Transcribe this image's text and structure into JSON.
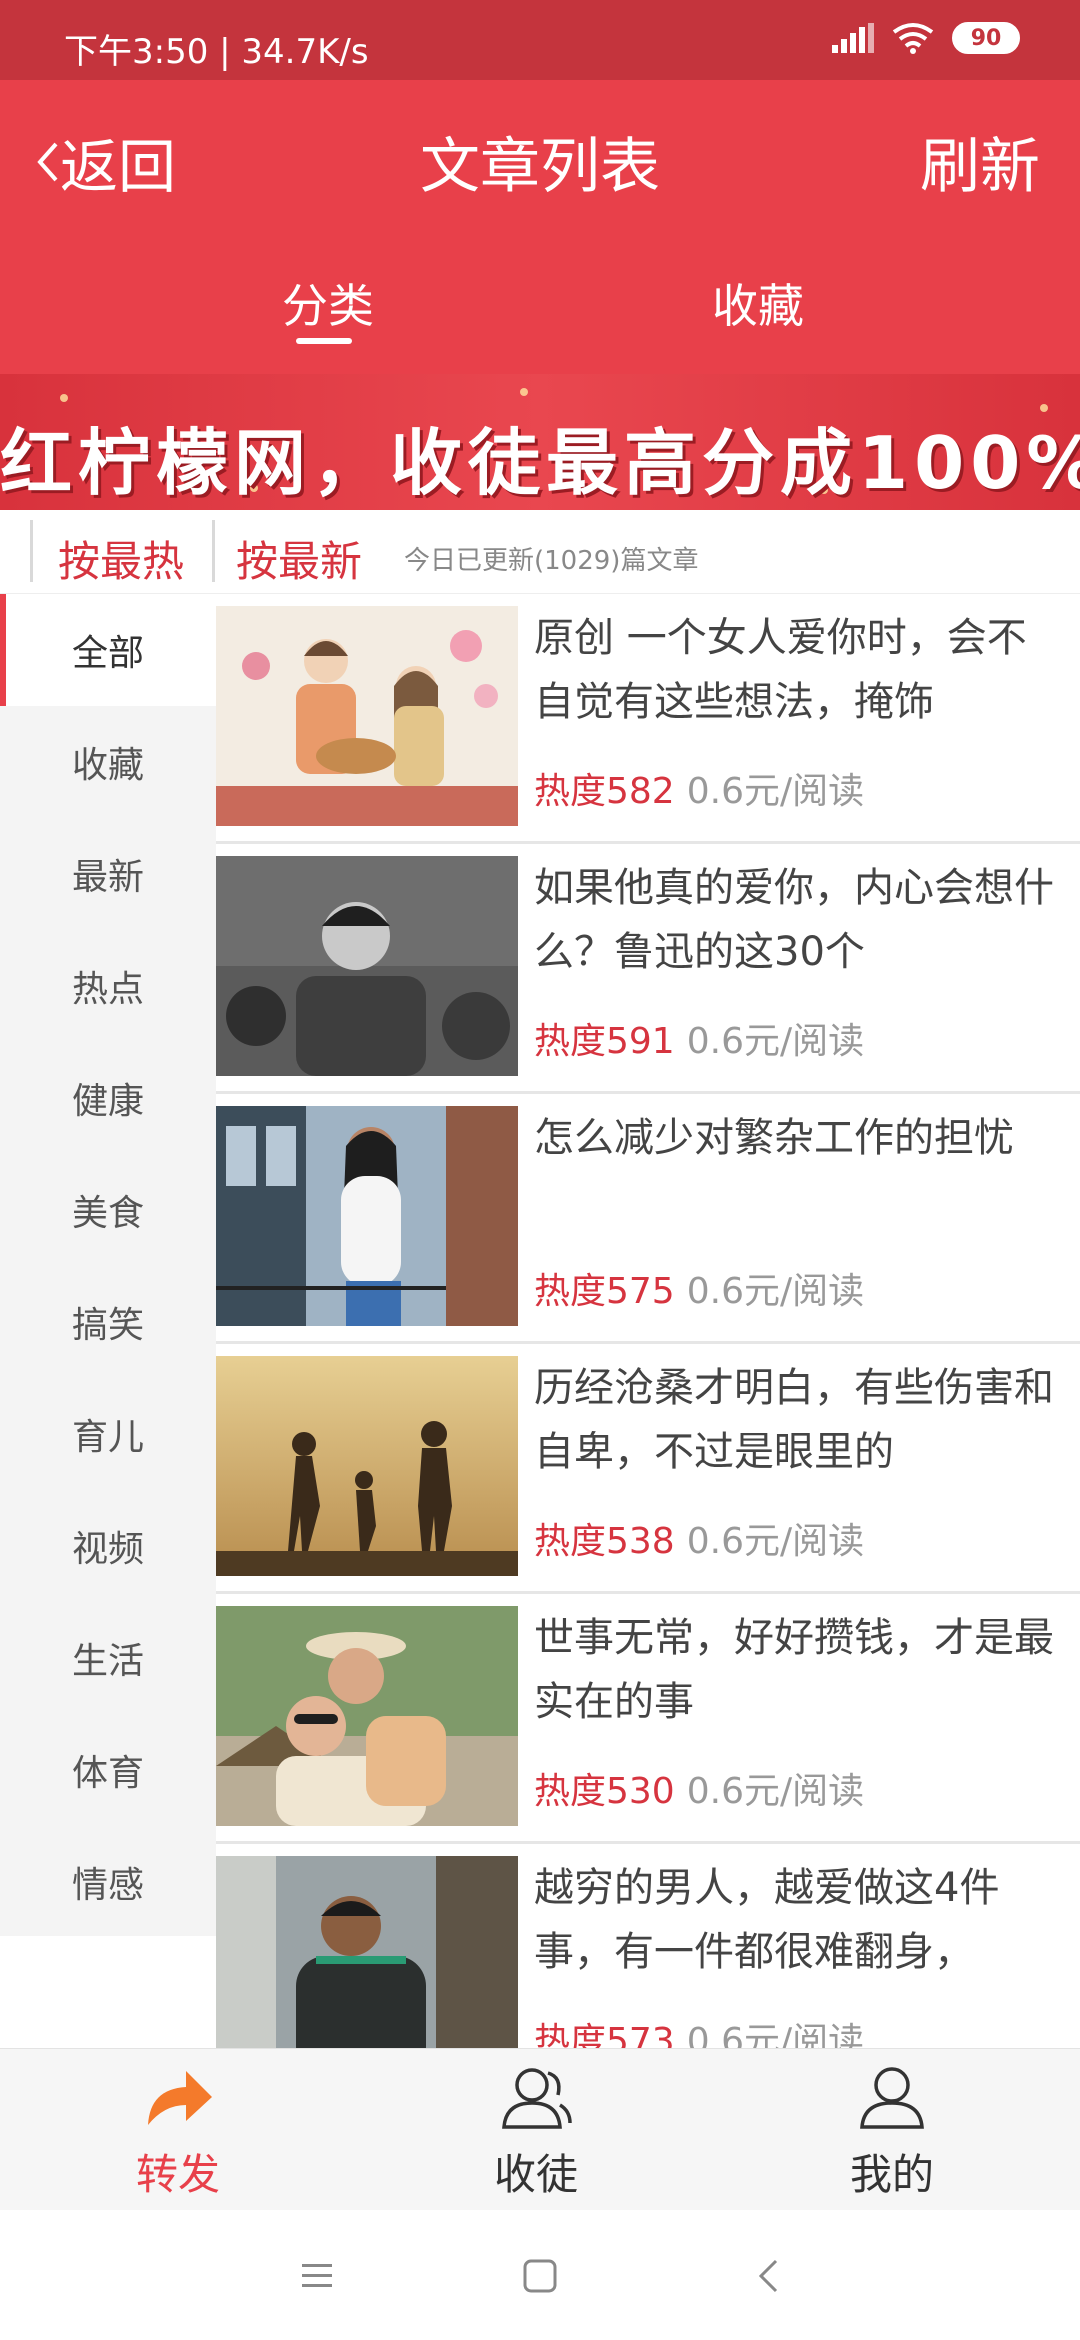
{
  "status": {
    "left": "下午3:50 | 34.7K/s",
    "battery": "90"
  },
  "header": {
    "back_label": "返回",
    "title": "文章列表",
    "refresh_label": "刷新"
  },
  "tabs": [
    {
      "label": "分类"
    },
    {
      "label": "收藏"
    }
  ],
  "banner": {
    "text": "红柠檬网，收徒最高分成100%"
  },
  "sort": {
    "hot_label": "按最热",
    "new_label": "按最新",
    "note": "今日已更新(1029)篇文章"
  },
  "sidebar": {
    "items": [
      {
        "label": "全部"
      },
      {
        "label": "收藏"
      },
      {
        "label": "最新"
      },
      {
        "label": "热点"
      },
      {
        "label": "健康"
      },
      {
        "label": "美食"
      },
      {
        "label": "搞笑"
      },
      {
        "label": "育儿"
      },
      {
        "label": "视频"
      },
      {
        "label": "生活"
      },
      {
        "label": "体育"
      },
      {
        "label": "情感"
      }
    ]
  },
  "articles": [
    {
      "title": "原创 一个女人爱你时，会不自觉有这些想法，掩饰",
      "heat": "热度582",
      "price": "0.6元/阅读"
    },
    {
      "title": "如果他真的爱你，内心会想什么？鲁迅的这30个",
      "heat": "热度591",
      "price": "0.6元/阅读"
    },
    {
      "title": "怎么减少对繁杂工作的担忧",
      "heat": "热度575",
      "price": "0.6元/阅读"
    },
    {
      "title": "历经沧桑才明白，有些伤害和自卑，不过是眼里的",
      "heat": "热度538",
      "price": "0.6元/阅读"
    },
    {
      "title": "世事无常，好好攒钱，才是最实在的事",
      "heat": "热度530",
      "price": "0.6元/阅读"
    },
    {
      "title": "越穷的男人，越爱做这4件事，有一件都很难翻身，",
      "heat": "热度573",
      "price": "0.6元/阅读"
    }
  ],
  "bottom_nav": [
    {
      "label": "转发"
    },
    {
      "label": "收徒"
    },
    {
      "label": "我的"
    }
  ],
  "colors": {
    "primary": "#e8404a",
    "status_bar": "#c4343d",
    "accent_orange": "#f47a2b"
  }
}
